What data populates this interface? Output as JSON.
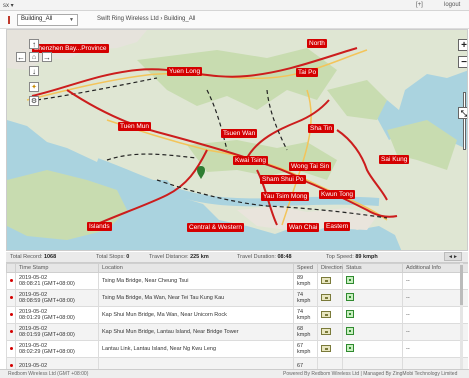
{
  "topbar": {
    "menu_label": "sx ▾",
    "login_label": "[+]",
    "logout_label": "logout"
  },
  "toolbar": {
    "building_select": "Building_All",
    "breadcrumb": "Swift Ring Wireless Ltd  ›  Building_All"
  },
  "map": {
    "places": [
      {
        "name": "Shenzhen Bay...Province"
      },
      {
        "name": "North"
      },
      {
        "name": "Yuen Long"
      },
      {
        "name": "Tai Po"
      },
      {
        "name": "Tuen Mun"
      },
      {
        "name": "Tsuen Wan"
      },
      {
        "name": "Sha Tin"
      },
      {
        "name": "Kwai Tsing"
      },
      {
        "name": "Wong Tai Sin"
      },
      {
        "name": "Sai Kung"
      },
      {
        "name": "Sham Shui Po"
      },
      {
        "name": "Yau Tsim Mong"
      },
      {
        "name": "Kwun Tong"
      },
      {
        "name": "Islands"
      },
      {
        "name": "Central & Western"
      },
      {
        "name": "Wan Chai"
      },
      {
        "name": "Eastern"
      }
    ],
    "nav": {
      "up": "↑",
      "down": "↓",
      "left": "←",
      "right": "→"
    },
    "zoom": {
      "in": "+",
      "out": "−"
    }
  },
  "summary": {
    "total_record_label": "Total Record:",
    "total_record": "1068",
    "total_stops_label": "Total Stops:",
    "total_stops": "0",
    "travel_distance_label": "Travel Distance:",
    "travel_distance": "225 km",
    "travel_duration_label": "Travel Duration:",
    "travel_duration": "08:48",
    "top_speed_label": "Top Speed:",
    "top_speed": "89 kmph",
    "tab_label": "◄►"
  },
  "table": {
    "headers": [
      "",
      "Time Stamp",
      "Location",
      "Speed",
      "Direction",
      "Status",
      "Additional Info"
    ],
    "rows": [
      {
        "date": "2019-05-02",
        "time": "08:08:21 (GMT+08:00)",
        "location": "Tsing Ma Bridge, Near Cheung Tsui",
        "speed": "89",
        "unit": "kmph",
        "info": "--"
      },
      {
        "date": "2019-05-02",
        "time": "08:08:59 (GMT+08:00)",
        "location": "Tsing Ma Bridge, Ma Wan, Near Tei Tau Kung Kau",
        "speed": "74",
        "unit": "kmph",
        "info": "--"
      },
      {
        "date": "2019-05-02",
        "time": "08:01:29 (GMT+08:00)",
        "location": "Kap Shui Mun Bridge, Ma Wan, Near Unicorn Rock",
        "speed": "74",
        "unit": "kmph",
        "info": "--"
      },
      {
        "date": "2019-05-02",
        "time": "08:01:59 (GMT+08:00)",
        "location": "Kap Shui Mun Bridge, Lantau Island, Near Bridge Tower",
        "speed": "68",
        "unit": "kmph",
        "info": "--"
      },
      {
        "date": "2019-05-02",
        "time": "08:02:29 (GMT+08:00)",
        "location": "Lantau Link, Lantau Island, Near Ng Kwu Leng",
        "speed": "67",
        "unit": "kmph",
        "info": "--"
      },
      {
        "date": "2019-05-02",
        "time": "",
        "location": "",
        "speed": "67",
        "unit": "",
        "info": ""
      }
    ]
  },
  "footer": {
    "left": "Redbom Wireless Ltd   (GMT +08:00)",
    "right": "Powered By Redbom Wireless Ltd  |  Managed By ZingMobi Technology Limited"
  }
}
